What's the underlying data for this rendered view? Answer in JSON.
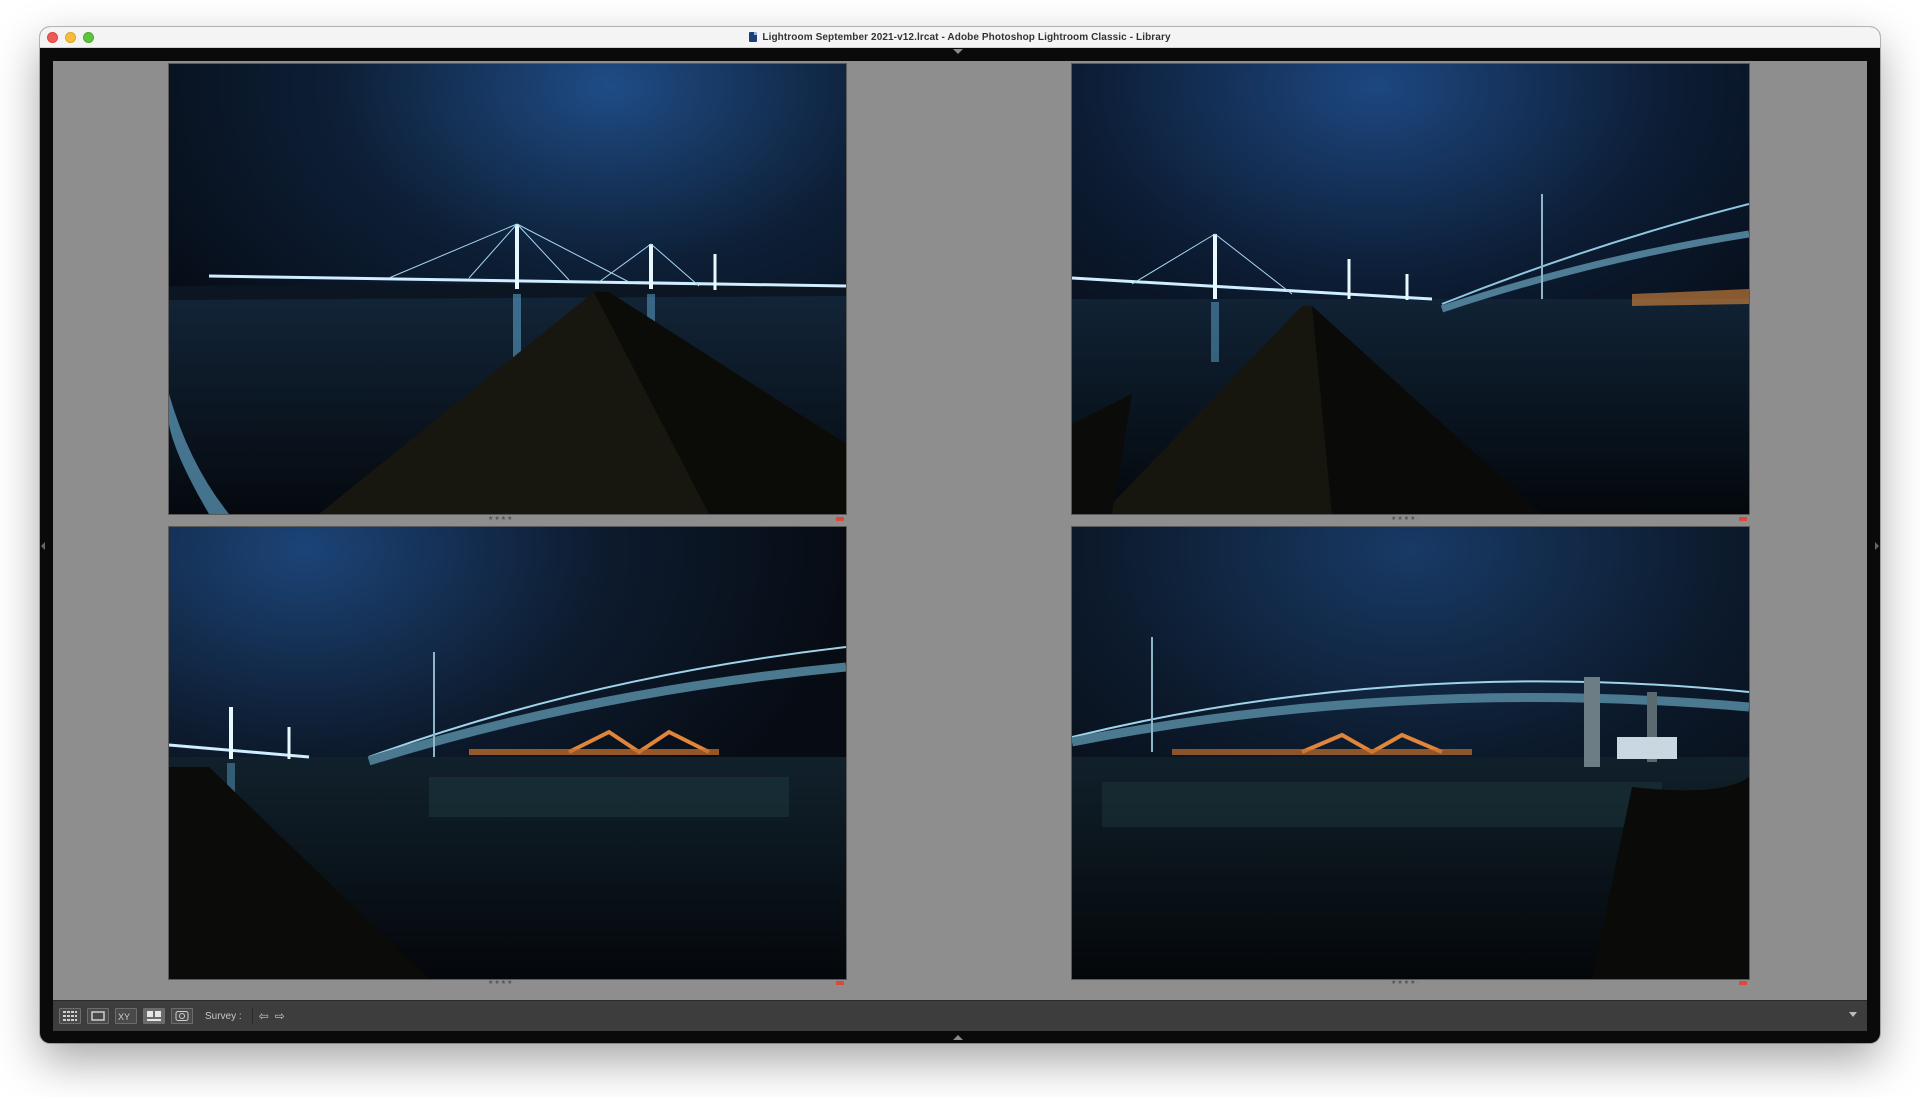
{
  "window": {
    "title": "Lightroom September 2021-v12.lrcat - Adobe Photoshop Lightroom Classic - Library"
  },
  "survey": {
    "photos": [
      {
        "stars": "★★★★·",
        "flag_color": "#d94a3e",
        "scene": "queensferry-crossing-pier"
      },
      {
        "stars": "★★★★·",
        "flag_color": "#d94a3e",
        "scene": "three-bridges-pier"
      },
      {
        "stars": "★★★★·",
        "flag_color": "#d94a3e",
        "scene": "forth-road-bridge-left"
      },
      {
        "stars": "★★★★·",
        "flag_color": "#d94a3e",
        "scene": "forth-road-bridge-wide"
      }
    ]
  },
  "toolbar": {
    "view_modes": [
      "grid-view-icon",
      "loupe-view-icon",
      "compare-view-icon",
      "survey-view-icon",
      "people-view-icon"
    ],
    "label": "Survey :",
    "prev_icon": "arrow-left-icon",
    "next_icon": "arrow-right-icon"
  },
  "colors": {
    "survey_background": "#8e8e8e",
    "toolbar_background": "#3d3d3d",
    "flag": "#d94a3e"
  }
}
